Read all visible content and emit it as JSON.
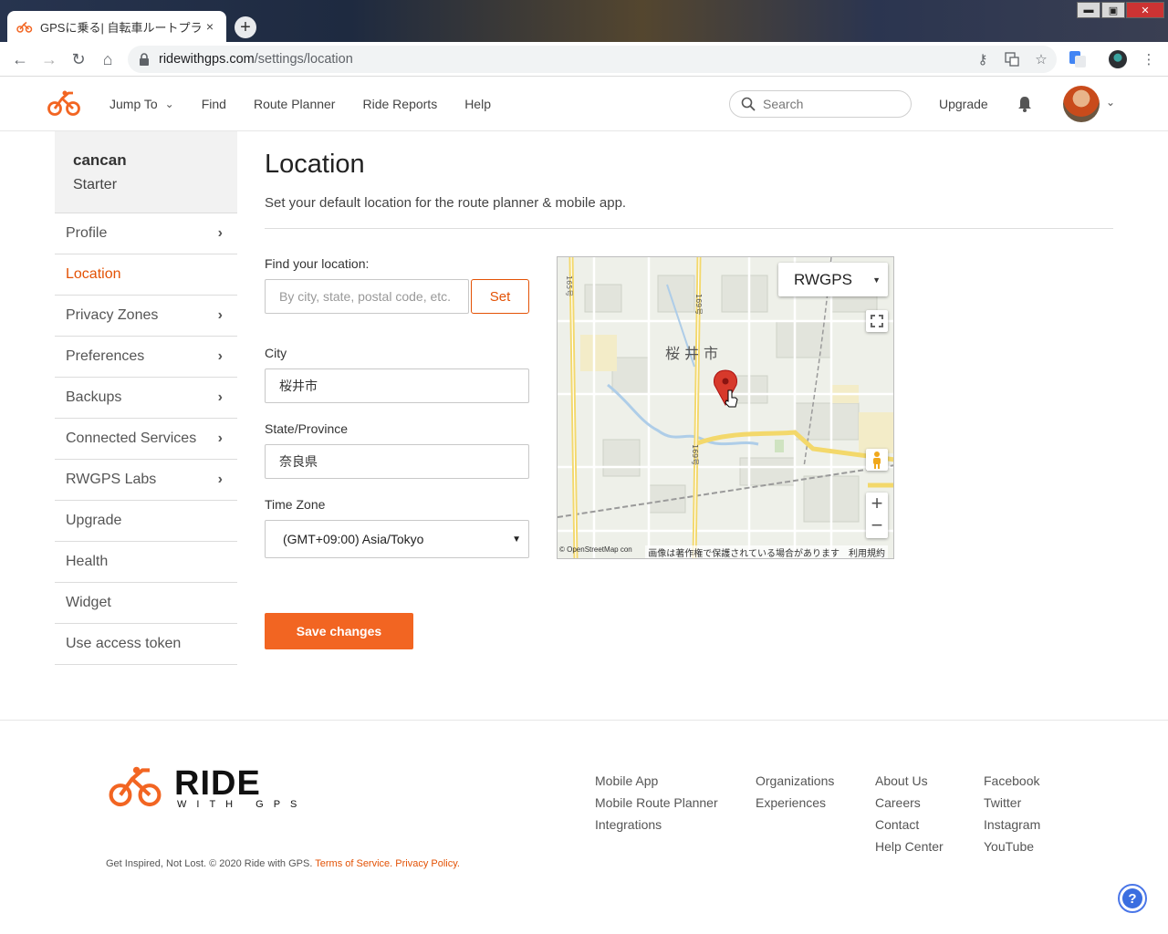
{
  "browser": {
    "tab_title": "GPSに乗る| 自転車ルートプラン",
    "tab_close": "×",
    "new_tab": "+",
    "url_host": "ridewithgps.com",
    "url_path": "/settings/location",
    "win_min": "▬",
    "win_max": "▣",
    "win_close": "✕"
  },
  "header": {
    "nav": [
      {
        "label": "Jump To",
        "has_menu": true
      },
      {
        "label": "Find"
      },
      {
        "label": "Route Planner"
      },
      {
        "label": "Ride Reports"
      },
      {
        "label": "Help"
      }
    ],
    "search_placeholder": "Search",
    "upgrade": "Upgrade",
    "brand_color": "#e35205"
  },
  "sidebar": {
    "username": "cancan",
    "plan": "Starter",
    "items": [
      {
        "label": "Profile",
        "arrow": true
      },
      {
        "label": "Location",
        "active": true
      },
      {
        "label": "Privacy Zones",
        "arrow": true
      },
      {
        "label": "Preferences",
        "arrow": true
      },
      {
        "label": "Backups",
        "arrow": true
      },
      {
        "label": "Connected Services",
        "arrow": true
      },
      {
        "label": "RWGPS Labs",
        "arrow": true
      },
      {
        "label": "Upgrade"
      },
      {
        "label": "Health"
      },
      {
        "label": "Widget"
      },
      {
        "label": "Use access token"
      }
    ]
  },
  "main": {
    "title": "Location",
    "subtitle": "Set your default location for the route planner & mobile app.",
    "find_label": "Find your location:",
    "find_placeholder": "By city, state, postal code, etc.",
    "set_button": "Set",
    "city_label": "City",
    "city_value": "桜井市",
    "state_label": "State/Province",
    "state_value": "奈良県",
    "tz_label": "Time Zone",
    "tz_value": "(GMT+09:00) Asia/Tokyo",
    "save_button": "Save changes"
  },
  "map": {
    "type_label": "RWGPS",
    "city_name": "桜井市",
    "attribution_left": "© OpenStreetMap contributors",
    "attribution_right": "画像は著作権で保護されている場合があります　利用規約",
    "zoom_in": "+",
    "zoom_out": "−",
    "route_numbers": [
      "169号",
      "169号",
      "165号"
    ]
  },
  "footer": {
    "brand_word": "RIDE",
    "brand_sub": "WITH GPS",
    "col1": [
      "Mobile App",
      "Mobile Route Planner",
      "Integrations"
    ],
    "col2": [
      "Organizations",
      "Experiences"
    ],
    "col3": [
      "About Us",
      "Careers",
      "Contact",
      "Help Center"
    ],
    "col4": [
      "Facebook",
      "Twitter",
      "Instagram",
      "YouTube"
    ],
    "copyright": "Get Inspired, Not Lost. © 2020 Ride with GPS.",
    "terms": "Terms of Service.",
    "privacy": "Privacy Policy.",
    "help": "?"
  }
}
